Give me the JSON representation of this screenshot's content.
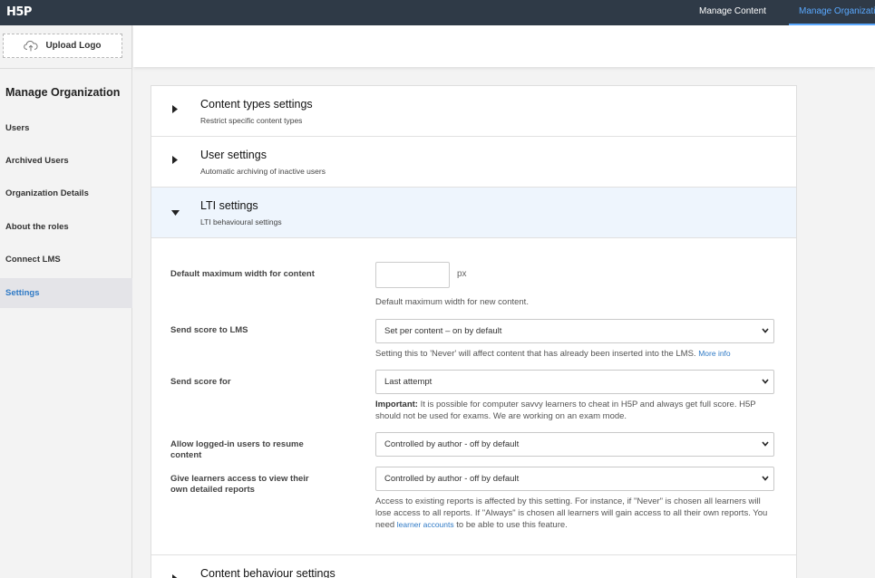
{
  "topbar": {
    "logo": "H5P",
    "nav": [
      "Manage Content",
      "Manage Organization"
    ]
  },
  "sidebar": {
    "upload_logo": "Upload Logo",
    "title": "Manage Organization",
    "items": [
      {
        "label": "Users"
      },
      {
        "label": "Archived Users"
      },
      {
        "label": "Organization Details"
      },
      {
        "label": "About the roles"
      },
      {
        "label": "Connect LMS"
      },
      {
        "label": "Settings",
        "active": true
      }
    ]
  },
  "sections": [
    {
      "title": "Content types settings",
      "subtitle": "Restrict specific content types",
      "expanded": false
    },
    {
      "title": "User settings",
      "subtitle": "Automatic archiving of inactive users",
      "expanded": false
    },
    {
      "title": "LTI settings",
      "subtitle": "LTI behavioural settings",
      "expanded": true
    },
    {
      "title": "Content behaviour settings"
    }
  ],
  "lti": {
    "max_width": {
      "label": "Default maximum width for content",
      "value": "",
      "unit": "px",
      "help": "Default maximum width for new content."
    },
    "send_score": {
      "label": "Send score to LMS",
      "selected": "Set per content – on by default",
      "help": "Setting this to 'Never' will affect content that has already been inserted into the LMS.",
      "link": "More info"
    },
    "send_score_for": {
      "label": "Send score for",
      "selected": "Last attempt",
      "help_strong": "Important:",
      "help": " It is possible for computer savvy learners to cheat in H5P and always get full score. H5P should not be used for exams. We are working on an exam mode."
    },
    "resume": {
      "label": "Allow logged-in users to resume content",
      "selected": "Controlled by author - off by default"
    },
    "reports": {
      "label": "Give learners access to view their own detailed reports",
      "selected": "Controlled by author - off by default",
      "help_before": "Access to existing reports is affected by this setting. For instance, if \"Never\" is chosen all learners will lose access to all reports. If \"Always\" is chosen all learners will gain access to all their own reports. You need ",
      "link": "learner accounts",
      "help_after": " to be able to use this feature."
    }
  },
  "colors": {
    "topbar": "#2f3a47",
    "accent": "#2f7ac6",
    "active_nav": "#5aa9ff",
    "expanded_section": "#eef5fd"
  }
}
